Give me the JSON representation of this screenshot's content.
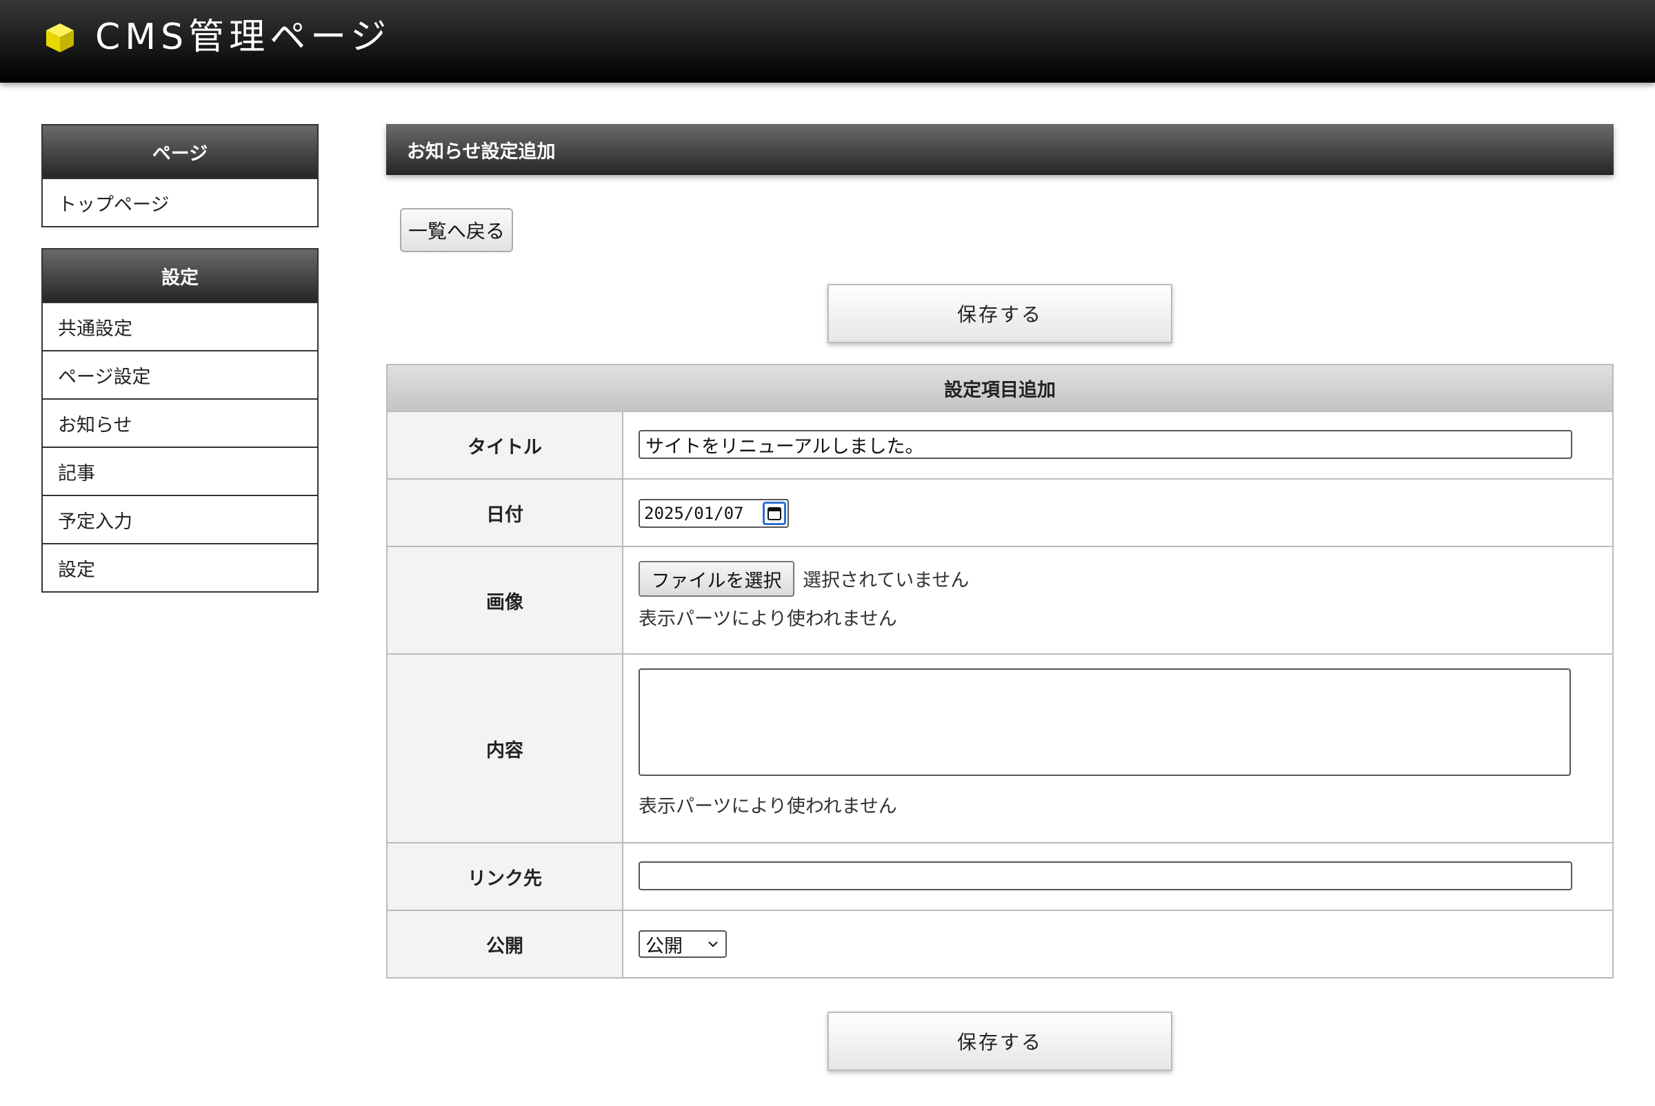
{
  "header": {
    "app_title": "CMS管理ページ",
    "logo_icon": "yellow-cube-icon"
  },
  "sidebar": {
    "groups": [
      {
        "heading": "ページ",
        "items": [
          {
            "label": "トップページ"
          }
        ]
      },
      {
        "heading": "設定",
        "items": [
          {
            "label": "共通設定"
          },
          {
            "label": "ページ設定"
          },
          {
            "label": "お知らせ"
          },
          {
            "label": "記事"
          },
          {
            "label": "予定入力"
          },
          {
            "label": "設定"
          }
        ]
      }
    ]
  },
  "main": {
    "section_title": "お知らせ設定追加",
    "back_button": "一覧へ戻る",
    "save_button": "保存する",
    "form": {
      "heading": "設定項目追加",
      "title_label": "タイトル",
      "title_value": "サイトをリニューアルしました。",
      "date_label": "日付",
      "date_value": "2025/01/07",
      "image_label": "画像",
      "file_button": "ファイルを選択",
      "file_status": "選択されていません",
      "image_note": "表示パーツにより使われません",
      "content_label": "内容",
      "content_value": "",
      "content_note": "表示パーツにより使われません",
      "link_label": "リンク先",
      "link_value": "",
      "publish_label": "公開",
      "publish_value": "公開"
    }
  },
  "colors": {
    "header_bg": "#000000",
    "heading_bg": "#3a3a3a",
    "logo": "#f2e600",
    "calendar_accent": "#2b6fd6"
  }
}
